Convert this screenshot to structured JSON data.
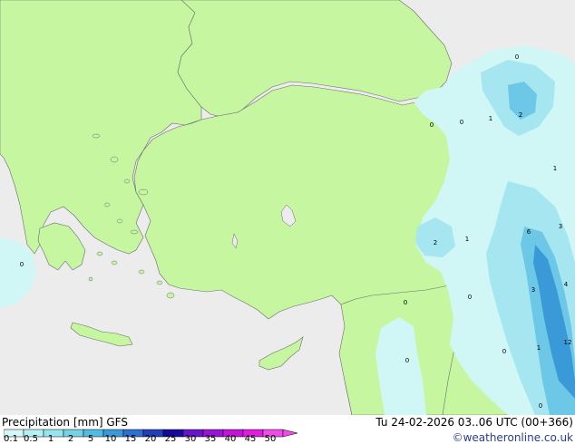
{
  "footer": {
    "title": "Precipitation [mm]  GFS",
    "datetime": "Tu 24-02-2026 03..06 UTC (00+366)",
    "credit": "©weatheronline.co.uk"
  },
  "legend": {
    "ticks": [
      "0.1",
      "0.5",
      "1",
      "2",
      "5",
      "10",
      "15",
      "20",
      "25",
      "30",
      "35",
      "40",
      "45",
      "50"
    ],
    "colors": [
      "#d4f8f8",
      "#b4f0f4",
      "#96e4ee",
      "#74d2e6",
      "#52bce0",
      "#3a9ad8",
      "#2f6fd0",
      "#2340b8",
      "#150a9c",
      "#6a14c8",
      "#9a14d4",
      "#c414d8",
      "#e01ce0",
      "#f04ce8"
    ]
  },
  "map": {
    "colors": {
      "sea": "#ececec",
      "land": "#c6f7a0",
      "precip_light": "#d0f6f6",
      "precip_medium": "#a6e6f0",
      "precip_heavy": "#6cc8e6",
      "precip_strong": "#3a9ad8",
      "coast": "#6b6b6b"
    },
    "labels": [
      "0",
      "1",
      "2",
      "0",
      "0",
      "1",
      "2",
      "1",
      "6",
      "3",
      "3",
      "4",
      "0",
      "0",
      "12",
      "1",
      "0",
      "0",
      "0",
      "0"
    ]
  }
}
